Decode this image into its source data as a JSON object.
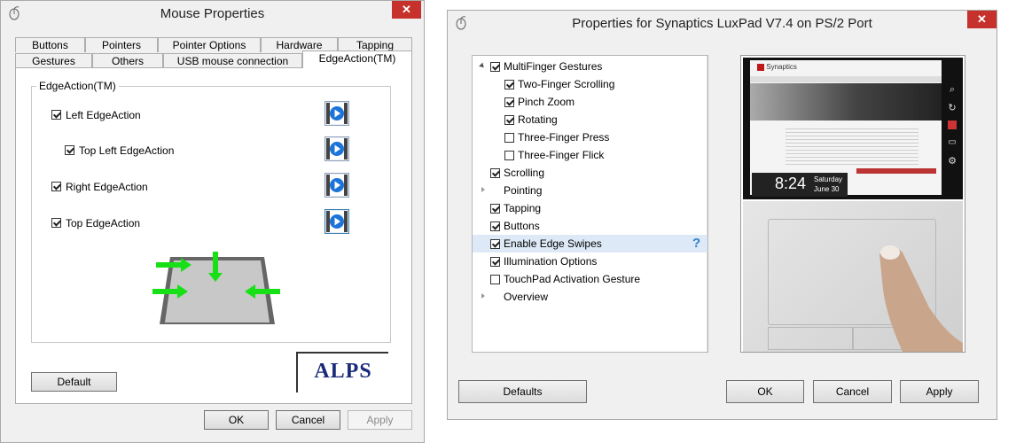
{
  "mouse_dialog": {
    "title": "Mouse Properties",
    "close": "✕",
    "tabs_row1": [
      "Buttons",
      "Pointers",
      "Pointer Options",
      "Hardware",
      "Tapping"
    ],
    "tabs_row2": [
      "Gestures",
      "Others",
      "USB mouse connection",
      "EdgeAction(TM)"
    ],
    "active_tab": "EdgeAction(TM)",
    "group_title": "EdgeAction(TM)",
    "options": [
      {
        "label": "Left EdgeAction",
        "checked": true
      },
      {
        "label": "Top Left EdgeAction",
        "checked": true
      },
      {
        "label": "Right EdgeAction",
        "checked": true
      },
      {
        "label": "Top EdgeAction",
        "checked": true
      }
    ],
    "logo": "ALPS",
    "default_button": "Default",
    "ok": "OK",
    "cancel": "Cancel",
    "apply": "Apply"
  },
  "synaptics_dialog": {
    "title": "Properties for Synaptics LuxPad V7.4 on PS/2 Port",
    "close": "✕",
    "tree": [
      {
        "label": "MultiFinger Gestures",
        "checked": true,
        "level": 0,
        "expander": "expanded"
      },
      {
        "label": "Two-Finger Scrolling",
        "checked": true,
        "level": 1
      },
      {
        "label": "Pinch Zoom",
        "checked": true,
        "level": 1
      },
      {
        "label": "Rotating",
        "checked": true,
        "level": 1
      },
      {
        "label": "Three-Finger Press",
        "checked": false,
        "level": 1
      },
      {
        "label": "Three-Finger Flick",
        "checked": false,
        "level": 1
      },
      {
        "label": "Scrolling",
        "checked": true,
        "level": 0
      },
      {
        "label": "Pointing",
        "checked": null,
        "level": 0,
        "expander": "collapsed"
      },
      {
        "label": "Tapping",
        "checked": true,
        "level": 0
      },
      {
        "label": "Buttons",
        "checked": true,
        "level": 0
      },
      {
        "label": "Enable Edge Swipes",
        "checked": true,
        "level": 0,
        "selected": true,
        "help": "?"
      },
      {
        "label": "Illumination Options",
        "checked": true,
        "level": 0
      },
      {
        "label": "TouchPad Activation Gesture",
        "checked": false,
        "level": 0
      },
      {
        "label": "Overview",
        "checked": null,
        "level": 0,
        "expander": "collapsed"
      }
    ],
    "preview": {
      "brand": "Synaptics",
      "time": "8:24",
      "day": "Saturday",
      "date": "June 30"
    },
    "defaults_button": "Defaults",
    "ok": "OK",
    "cancel": "Cancel",
    "apply": "Apply"
  },
  "colors": {
    "close_red": "#c7312c",
    "frame": "#a9a9a9",
    "selection": "#dde9f6",
    "play_blue": "#1c74d8",
    "arrow_green": "#17e017"
  }
}
